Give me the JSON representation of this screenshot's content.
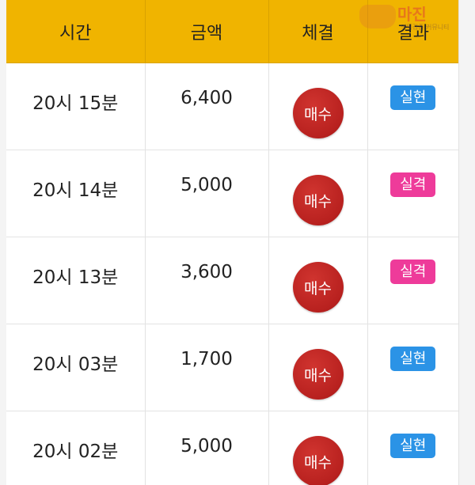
{
  "header": {
    "time": "시간",
    "amount": "금액",
    "trade": "체결",
    "result": "결과"
  },
  "rows": [
    {
      "time": "20시 15분",
      "amount": "6,400",
      "trade": "매수",
      "result": "실현",
      "result_type": "success"
    },
    {
      "time": "20시 14분",
      "amount": "5,000",
      "trade": "매수",
      "result": "실격",
      "result_type": "fail"
    },
    {
      "time": "20시 13분",
      "amount": "3,600",
      "trade": "매수",
      "result": "실격",
      "result_type": "fail"
    },
    {
      "time": "20시 03분",
      "amount": "1,700",
      "trade": "매수",
      "result": "실현",
      "result_type": "success"
    },
    {
      "time": "20시 02분",
      "amount": "5,000",
      "trade": "매수",
      "result": "실현",
      "result_type": "success"
    }
  ],
  "watermark": {
    "brand": "마진",
    "sub": "먹튀검증 커뮤니티"
  },
  "colors": {
    "header_bg": "#f0b400",
    "buy": "#b8211f",
    "success": "#2b93e6",
    "fail": "#ee3b9a"
  }
}
